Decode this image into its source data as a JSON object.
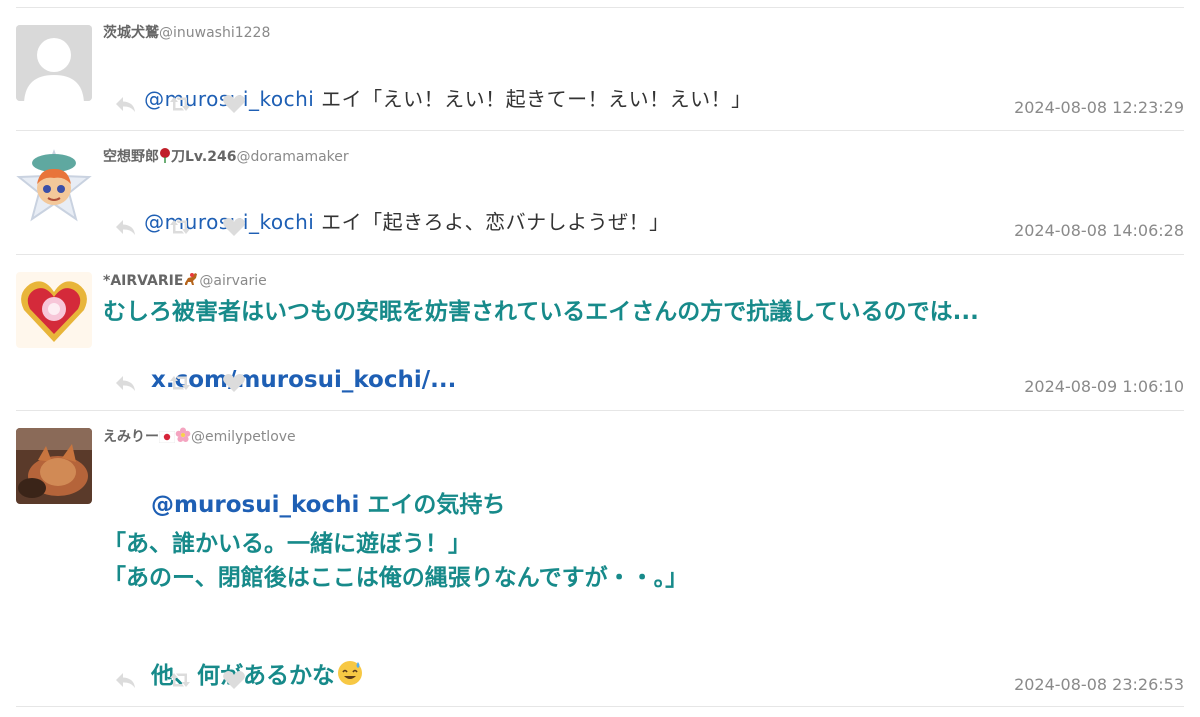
{
  "tweets": [
    {
      "author": "茨城犬鷲",
      "handle": "@inuwashi1228",
      "mention": "@murosui_kochi",
      "text": " エイ「えい！えい！起きてー！えい！えい！」",
      "timestamp": "2024-08-08 12:23:29"
    },
    {
      "author": "空想野郎",
      "author_suffix": "刀Lv.246",
      "handle": "@doramamaker",
      "mention": "@murosui_kochi",
      "text": " エイ「起きろよ、恋バナしようぜ！」",
      "timestamp": "2024-08-08 14:06:28"
    },
    {
      "author": "*AIRVARIE",
      "handle": "@airvarie",
      "text_line1": "むしろ被害者はいつもの安眠を妨害されているエイさんの方で抗議しているのでは...",
      "link": "x.com/murosui_kochi/...",
      "timestamp": "2024-08-09 1:06:10"
    },
    {
      "author": "えみりー",
      "handle": "@emilypetlove",
      "mention": "@murosui_kochi",
      "text_line1": " エイの気持ち",
      "text_line2": "「あ、誰かいる。一緒に遊ぼう！」",
      "text_line3": "「あのー、閉館後はここは俺の縄張りなんですが・・。」",
      "text_line4": "他、何があるかな",
      "timestamp": "2024-08-08 23:26:53"
    }
  ],
  "icons": {
    "reply": "reply-icon",
    "retweet": "retweet-icon",
    "like": "heart-icon"
  },
  "colors": {
    "mention": "#1e5fb4",
    "highlight_text": "#178a8a",
    "action_icon": "#dcdcdc",
    "meta_text": "#8a8a8a"
  }
}
